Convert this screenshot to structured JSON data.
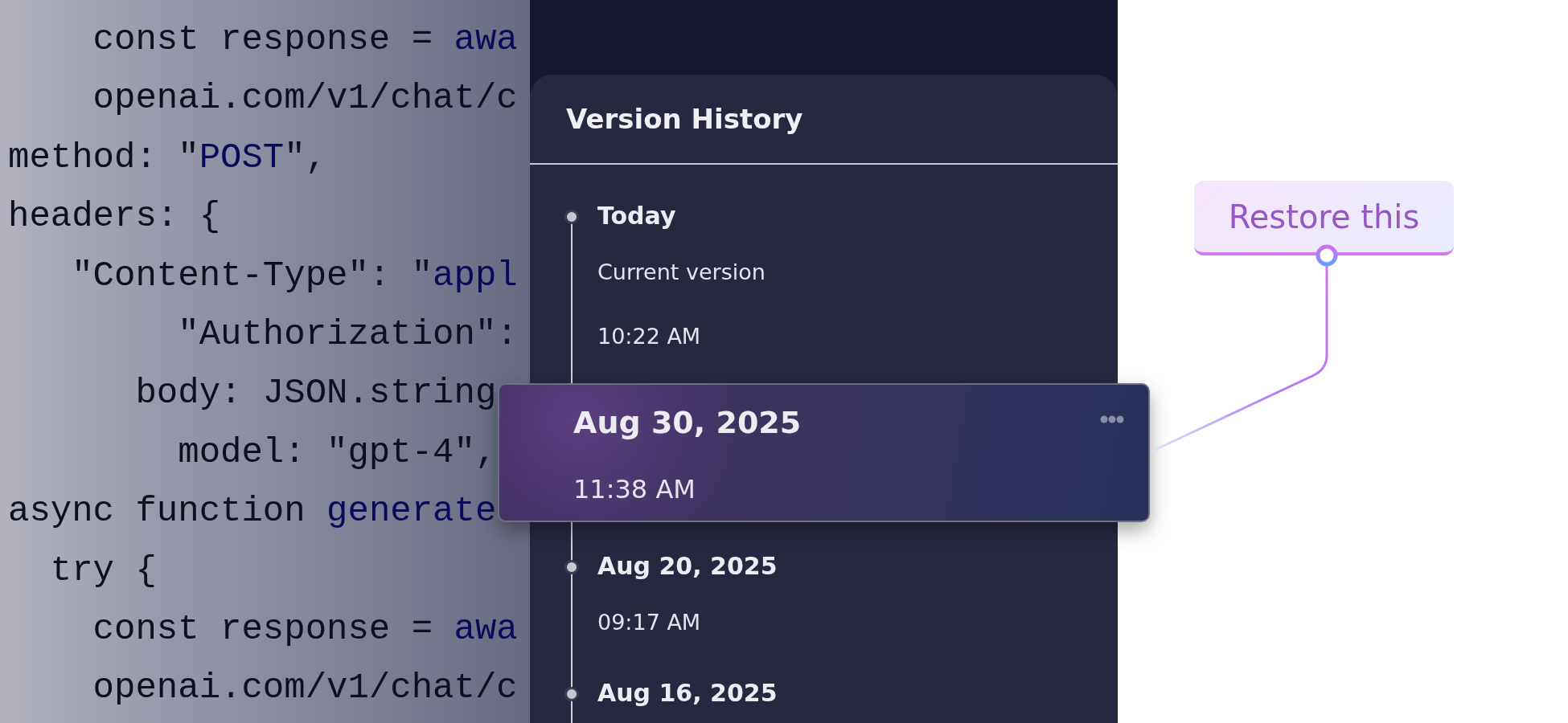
{
  "code_lines": [
    {
      "segments": [
        {
          "text": "    const response = ",
          "kind": "plain"
        },
        {
          "text": "awa",
          "kind": "keyword"
        }
      ]
    },
    {
      "segments": [
        {
          "text": "    openai.com/v1/chat/c",
          "kind": "plain"
        }
      ]
    },
    {
      "segments": [
        {
          "text": "method: \"",
          "kind": "plain"
        },
        {
          "text": "POST",
          "kind": "keyword"
        },
        {
          "text": "\",",
          "kind": "plain"
        }
      ]
    },
    {
      "segments": [
        {
          "text": "headers: {",
          "kind": "plain"
        }
      ]
    },
    {
      "segments": [
        {
          "text": "   \"Content-Type\": \"",
          "kind": "plain"
        },
        {
          "text": "appl",
          "kind": "keyword"
        }
      ]
    },
    {
      "segments": [
        {
          "text": "        \"Authorization\":",
          "kind": "plain"
        }
      ]
    },
    {
      "segments": [
        {
          "text": "      body: JSON.string",
          "kind": "plain"
        }
      ]
    },
    {
      "segments": [
        {
          "text": "        model: \"gpt-4\",",
          "kind": "plain"
        }
      ]
    },
    {
      "segments": [
        {
          "text": "async function ",
          "kind": "plain"
        },
        {
          "text": "generate",
          "kind": "keyword"
        }
      ]
    },
    {
      "segments": [
        {
          "text": "  try {",
          "kind": "plain"
        }
      ]
    },
    {
      "segments": [
        {
          "text": "    const response = ",
          "kind": "plain"
        },
        {
          "text": "awa",
          "kind": "keyword"
        }
      ]
    },
    {
      "segments": [
        {
          "text": "    openai.com/v1/chat/c",
          "kind": "plain"
        }
      ]
    }
  ],
  "panel": {
    "title": "Version History",
    "versions": [
      {
        "date": "Today",
        "lines": [
          "Current version",
          "10:22 AM"
        ],
        "selected": false
      },
      {
        "date": "Aug 30, 2025",
        "lines": [
          "11:38 AM"
        ],
        "selected": true
      },
      {
        "date": "Aug 20, 2025",
        "lines": [
          "09:17 AM"
        ],
        "selected": false
      },
      {
        "date": "Aug 16, 2025",
        "selected": false
      }
    ]
  },
  "restore_button": {
    "label": "Restore this"
  }
}
